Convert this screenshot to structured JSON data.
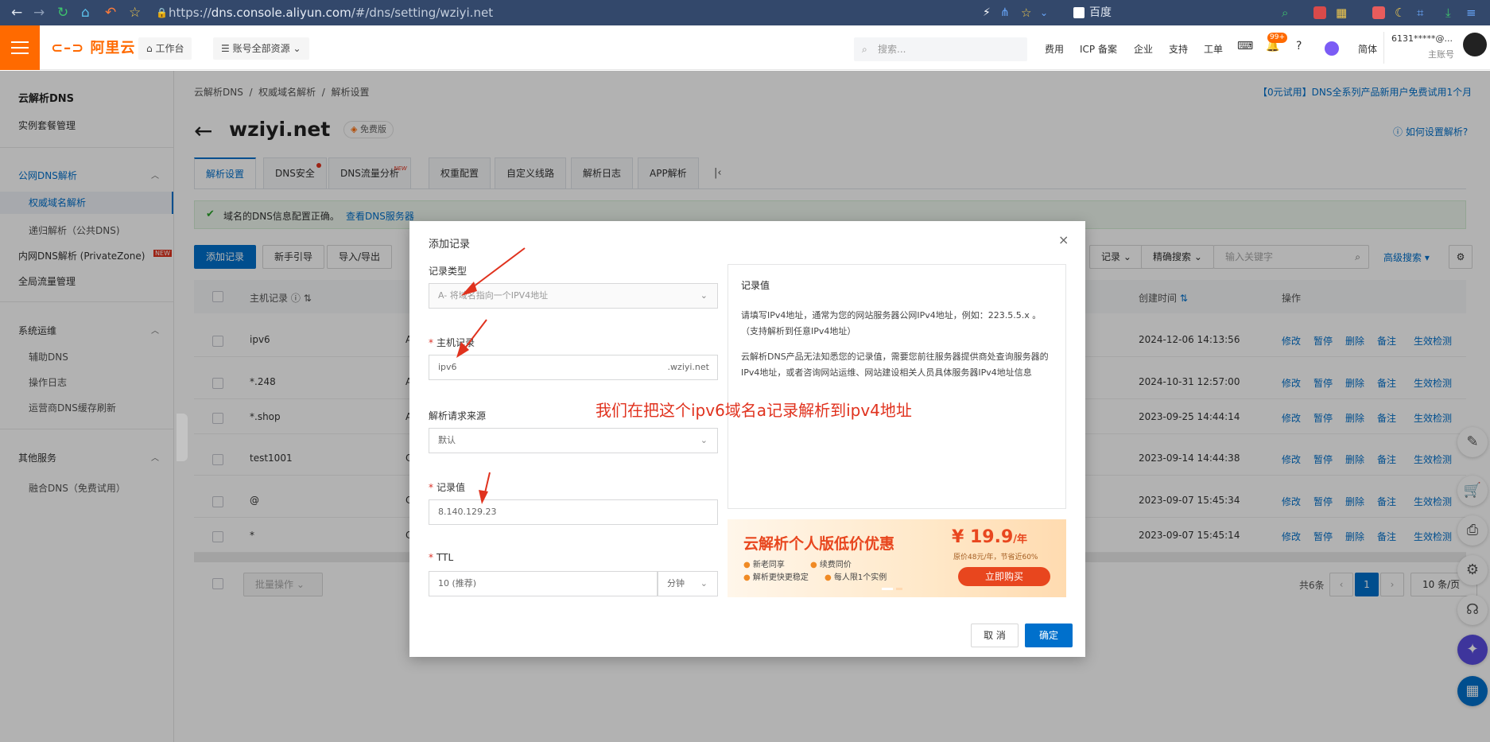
{
  "browser": {
    "url_prefix": "https://",
    "url_host": "dns.console.aliyun.com",
    "url_path": "/#/dns/setting/wziyi.net",
    "search_engine": "百度"
  },
  "topbar": {
    "logo": "阿里云",
    "workbench": "工作台",
    "resources": "账号全部资源",
    "search_placeholder": "搜索...",
    "links": [
      "费用",
      "ICP 备案",
      "企业",
      "支持",
      "工单"
    ],
    "badge": "99+",
    "lang": "简体",
    "account": "6131*****@...",
    "account_role": "主账号"
  },
  "sidebar": {
    "title": "云解析DNS",
    "instance": "实例套餐管理",
    "public_group": "公网DNS解析",
    "authoritative": "权威域名解析",
    "recursive": "递归解析（公共DNS)",
    "private": "内网DNS解析 (PrivateZone)",
    "private_badge": "NEW",
    "traffic": "全局流量管理",
    "ops_group": "系统运维",
    "aux_dns": "辅助DNS",
    "op_log": "操作日志",
    "cache_refresh": "运营商DNS缓存刷新",
    "other_group": "其他服务",
    "fusion": "融合DNS（免费试用）"
  },
  "main": {
    "breadcrumb": [
      "云解析DNS",
      "权威域名解析",
      "解析设置"
    ],
    "promo": "【0元试用】DNS全系列产品新用户免费试用1个月",
    "domain": "wziyi.net",
    "edition": "免费版",
    "help": "如何设置解析?",
    "tabs": [
      "解析设置",
      "DNS安全",
      "DNS流量分析",
      "权重配置",
      "自定义线路",
      "解析日志",
      "APP解析"
    ],
    "tab_new": "NEW",
    "status_msg": "域名的DNS信息配置正确。",
    "status_link": "查看DNS服务器",
    "toolbar": {
      "add": "添加记录",
      "guide": "新手引导",
      "import": "导入/导出",
      "record_filter": "记录",
      "exact": "精确搜索",
      "kw_placeholder": "输入关键字",
      "advanced": "高级搜索"
    },
    "columns": {
      "host": "主机记录",
      "created": "创建时间",
      "ops": "操作"
    },
    "rows": [
      {
        "host": "ipv6",
        "col2": "A",
        "created": "2024-12-06 14:13:56"
      },
      {
        "host": "*.248",
        "col2": "A",
        "created": "2024-10-31 12:57:00"
      },
      {
        "host": "*.shop",
        "col2": "A",
        "created": "2023-09-25 14:44:14"
      },
      {
        "host": "test1001",
        "col2": "C",
        "created": "2023-09-14 14:44:38"
      },
      {
        "host": "@",
        "col2": "C",
        "created": "2023-09-07 15:45:34"
      },
      {
        "host": "*",
        "col2": "C",
        "created": "2023-09-07 15:45:14"
      }
    ],
    "row_ops": [
      "修改",
      "暂停",
      "删除",
      "备注",
      "生效检测"
    ],
    "batch": "批量操作",
    "total": "共6条",
    "page": "1",
    "page_size": "10 条/页"
  },
  "dialog": {
    "title": "添加记录",
    "type_label": "记录类型",
    "type_value": "A- 将域名指向一个IPV4地址",
    "host_label": "主机记录",
    "host_value": "ipv6",
    "host_suffix": ".wziyi.net",
    "source_label": "解析请求来源",
    "source_value": "默认",
    "value_label": "记录值",
    "value_value": "8.140.129.23",
    "ttl_label": "TTL",
    "ttl_value": "10 (推荐)",
    "ttl_unit": "分钟",
    "note_title": "记录值",
    "note_p1": "请填写IPv4地址，通常为您的网站服务器公网IPv4地址，例如：223.5.5.x 。（支持解析到任意IPv4地址）",
    "note_p2": "云解析DNS产品无法知悉您的记录值，需要您前往服务器提供商处查询服务器的IPv4地址，或者咨询网站运维、网站建设相关人员具体服务器IPv4地址信息",
    "banner": {
      "title": "云解析个人版低价优惠",
      "price": "¥ 19.9",
      "unit": "/年",
      "orig": "原价48元/年，节省近60%",
      "f1": "新老同享",
      "f2": "续费同价",
      "f3": "解析更快更稳定",
      "f4": "每人限1个实例",
      "cta": "立即购买"
    },
    "cancel": "取 消",
    "confirm": "确定"
  },
  "annotation": "我们在把这个ipv6域名a记录解析到ipv4地址"
}
